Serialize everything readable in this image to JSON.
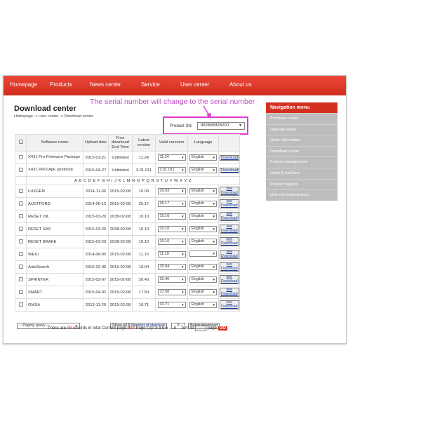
{
  "nav": {
    "items": [
      "Homepage",
      "Products",
      "News center",
      "Service",
      "User center",
      "About us"
    ]
  },
  "header": {
    "title": "Download center",
    "breadcrumb": "Homepage -> User center -> Download center"
  },
  "annotation": {
    "text": "The serial number will change to the serial number",
    "color": "#b94cc4",
    "highlight_color": "#e03bd1"
  },
  "product_sn": {
    "label": "Product SN:",
    "value": "982698926200"
  },
  "table": {
    "headers": [
      "Software name",
      "Upload date",
      "Free download End Time",
      "Latest version",
      "Valid versions",
      "Language"
    ],
    "alphabet": "A B C D E F G H I J K L M N O P Q R S T U V W X Y Z",
    "download_label": "Download",
    "see_label": "see",
    "top_rows": [
      {
        "name": "X431 Pro Firmware Package",
        "upload": "2015-01-21",
        "end": "Unlimited",
        "latest": "11.24",
        "valid": "11.24",
        "language": "English"
      },
      {
        "name": "X431 PRO Apk (android)",
        "upload": "2015-04-27",
        "end": "Unlimited",
        "latest": "3.01.011",
        "valid": "3.01.011",
        "language": "English"
      }
    ],
    "rows": [
      {
        "name": "LUXGEN",
        "upload": "2014-11-06",
        "end": "2015-02-08",
        "latest": "10.03",
        "valid": "10.03",
        "language": "English"
      },
      {
        "name": "AUSTFORD",
        "upload": "2014-06-12",
        "end": "2015-02-08",
        "latest": "25.17",
        "valid": "25.17",
        "language": "English"
      },
      {
        "name": "RESET OIL",
        "upload": "2015-03-20",
        "end": "2038-02-08",
        "latest": "10.10",
        "valid": "10.10",
        "language": "English"
      },
      {
        "name": "RESET SAS",
        "upload": "2015-03-20",
        "end": "2038-02-08",
        "latest": "10.10",
        "valid": "10.10",
        "language": "English"
      },
      {
        "name": "RESET BRAKE",
        "upload": "2015-03-20",
        "end": "2038-02-08",
        "latest": "10.10",
        "valid": "10.10",
        "language": "English"
      },
      {
        "name": "WEILI",
        "upload": "2014-08-05",
        "end": "2015-02-08",
        "latest": "11.10",
        "valid": "11.10",
        "language": ""
      },
      {
        "name": "AutoSearch",
        "upload": "2015-02-05",
        "end": "2015-02-08",
        "latest": "10.04",
        "valid": "10.04",
        "language": "English"
      },
      {
        "name": "SPRINTER",
        "upload": "2015-02-07",
        "end": "2015-02-08",
        "latest": "20.40",
        "valid": "20.40",
        "language": "English"
      },
      {
        "name": "SMART",
        "upload": "2015-04-02",
        "end": "2015-02-08",
        "latest": "17.50",
        "valid": "17.50",
        "language": "English"
      },
      {
        "name": "GMSA",
        "upload": "2013-11-29",
        "end": "2015-02-08",
        "latest": "10.71",
        "valid": "10.71",
        "language": "English"
      }
    ]
  },
  "toolbar": {
    "paging_select": "-- Paging query --",
    "show_all": "Show all",
    "number_checked": "Number of checked",
    "count": "0",
    "batch_download": "Batch download"
  },
  "pager": {
    "prefix": "There are",
    "total": "88",
    "middle": "records in total Current page:",
    "current": "1/8",
    "page_word": "Page",
    "pages": "[1]2 3 4 5 6 ... 8",
    "turn_to": "Turn to",
    "page_suffix": "page",
    "go": "GO"
  },
  "sidebar": {
    "title": "Navigation menu",
    "items": [
      "Purchase center",
      "Upgrade center",
      "Order information",
      "Download center",
      "Product management",
      "Users E-mail box",
      "Product register",
      "User info maintenance"
    ]
  },
  "colors": {
    "brand_red": "#d42f20",
    "sidebar_gray": "#bdbdbd",
    "link_blue": "#1a3f9c"
  }
}
